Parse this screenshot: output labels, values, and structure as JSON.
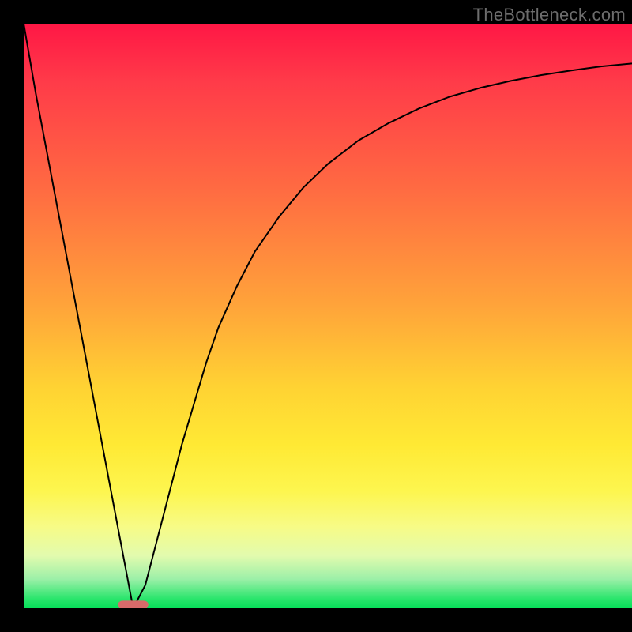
{
  "watermark": {
    "text": "TheBottleneck.com"
  },
  "chart_data": {
    "type": "line",
    "title": "",
    "xlabel": "",
    "ylabel": "",
    "xlim": [
      0,
      100
    ],
    "ylim": [
      0,
      100
    ],
    "background_gradient": {
      "direction": "vertical",
      "stops": [
        {
          "pos": 0,
          "color": "#ff1745"
        },
        {
          "pos": 28,
          "color": "#ff6a42"
        },
        {
          "pos": 48,
          "color": "#ffa33a"
        },
        {
          "pos": 72,
          "color": "#ffe934"
        },
        {
          "pos": 90,
          "color": "#e2fbae"
        },
        {
          "pos": 100,
          "color": "#06df59"
        }
      ]
    },
    "series": [
      {
        "name": "bottleneck-v-curve",
        "color": "#000000",
        "x": [
          0,
          2,
          4,
          6,
          8,
          10,
          12,
          14,
          16,
          18,
          20,
          22,
          24,
          26,
          28,
          30,
          32,
          35,
          38,
          42,
          46,
          50,
          55,
          60,
          65,
          70,
          75,
          80,
          85,
          90,
          95,
          100
        ],
        "y": [
          100,
          88,
          77,
          66,
          55,
          44,
          33,
          22,
          11,
          0,
          4,
          12,
          20,
          28,
          35,
          42,
          48,
          55,
          61,
          67,
          72,
          76,
          80,
          83,
          85.5,
          87.5,
          89,
          90.2,
          91.2,
          92,
          92.7,
          93.2
        ]
      }
    ],
    "marker": {
      "name": "minimum-marker",
      "x": 18,
      "y": 0,
      "width": 5,
      "height": 1.3,
      "color": "#d86a6a",
      "rx": 0.8
    }
  }
}
